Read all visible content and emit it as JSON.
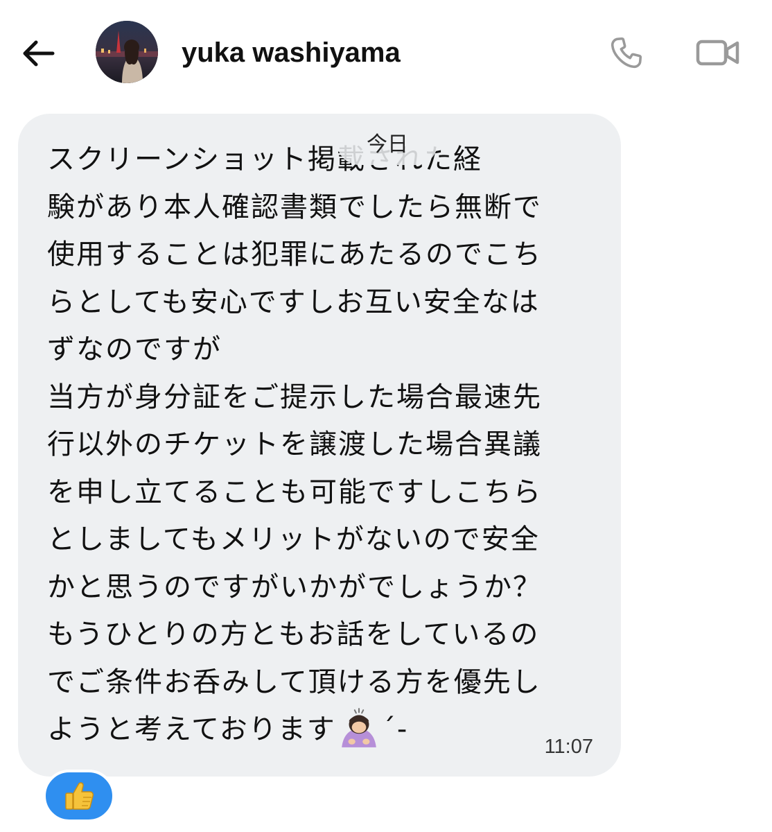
{
  "header": {
    "contact_name": "yuka washiyama",
    "back_icon": "arrow-left-icon",
    "call_icon": "phone-icon",
    "video_icon": "video-camera-icon"
  },
  "date_separator": "今日",
  "message": {
    "lines": [
      "スクリーンショット掲載された経",
      "験があり本人確認書類でしたら無断で",
      "使用することは犯罪にあたるのでこち",
      "らとしても安心ですしお互い安全なは",
      "ずなのですが",
      "当方が身分証をご提示した場合最速先",
      "行以外のチケットを譲渡した場合異議",
      "を申し立てることも可能ですしこちら",
      "としましてもメリットがないので安全",
      "かと思うのですがいかがでしょうか？",
      "もうひとりの方ともお話をしているの",
      "でご条件お呑みして頂ける方を優先し",
      "ようと考えております"
    ],
    "tail_emoji": "person-bowing-emoji",
    "tail_suffix": "´-",
    "time": "11:07"
  },
  "reaction": {
    "emoji": "👍",
    "icon": "thumbs-up-icon"
  },
  "colors": {
    "bubble_bg": "#eef0f2",
    "reaction_bg": "#2f8ff0",
    "icon_gray": "#9a9a9a",
    "text": "#111111"
  }
}
